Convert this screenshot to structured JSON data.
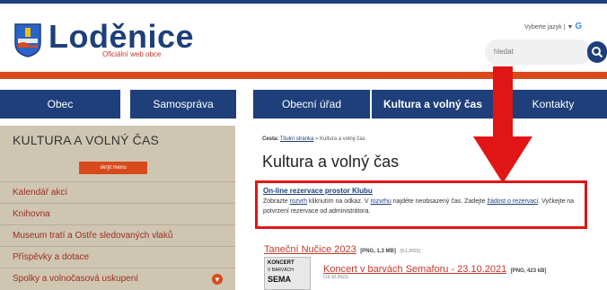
{
  "header": {
    "brand": "Loděnice",
    "brand_subtitle": "Oficiální web obce",
    "language_label": "Vyberte jazyk",
    "search_placeholder": "hledat"
  },
  "nav": {
    "items": [
      "Obec",
      "Samospráva",
      "Obecní úřad",
      "Kultura a volný čas",
      "Kontakty"
    ],
    "active": "Kultura a volný čas"
  },
  "sidebar": {
    "title": "KULTURA A VOLNÝ ČAS",
    "hide_menu_label": "skrýt menu",
    "items": [
      "Kalendář akcí",
      "Knihovna",
      "Museum tratí a Ostře sledovaných vlaků",
      "Příspěvky a dotace",
      "Spolky a volnočasová uskupení"
    ]
  },
  "main": {
    "breadcrumb_prefix": "Cesta:",
    "breadcrumb_home": "Titulní stránka",
    "breadcrumb_current": "» Kultura a volný čas",
    "title": "Kultura a volný čas",
    "notice": {
      "link": "On-line rezervace prostor Klubu",
      "t1": "Zobrazte ",
      "l1": "rozvrh",
      "t2": " kliknutím na odkaz. V ",
      "l2": "rozvrhu",
      "t3": " najdéte neobsazený čas. Zadejte ",
      "l3": "žádost o rezervaci",
      "t4": ". Vyčkejte na potvrzení rezervace od administrátora."
    },
    "downloads": [
      {
        "title": "Taneční Nučice 2023",
        "meta": "[PNG, 1,3 MB]",
        "date": "(9.1.2023)"
      },
      {
        "title": "Koncert v barvách Semaforu - 23.10.2021",
        "meta": "[PNG, 423 kB]",
        "date": "(13.10.2021)"
      }
    ],
    "thumbnail": {
      "line1": "KONCERT",
      "line2": "V BARVÁCH",
      "line3": "SEMA"
    }
  },
  "colors": {
    "primary": "#1e3f7a",
    "accent": "#d84a1b",
    "sidebar_bg": "#cfc6b2",
    "annotation_red": "#e11515"
  }
}
